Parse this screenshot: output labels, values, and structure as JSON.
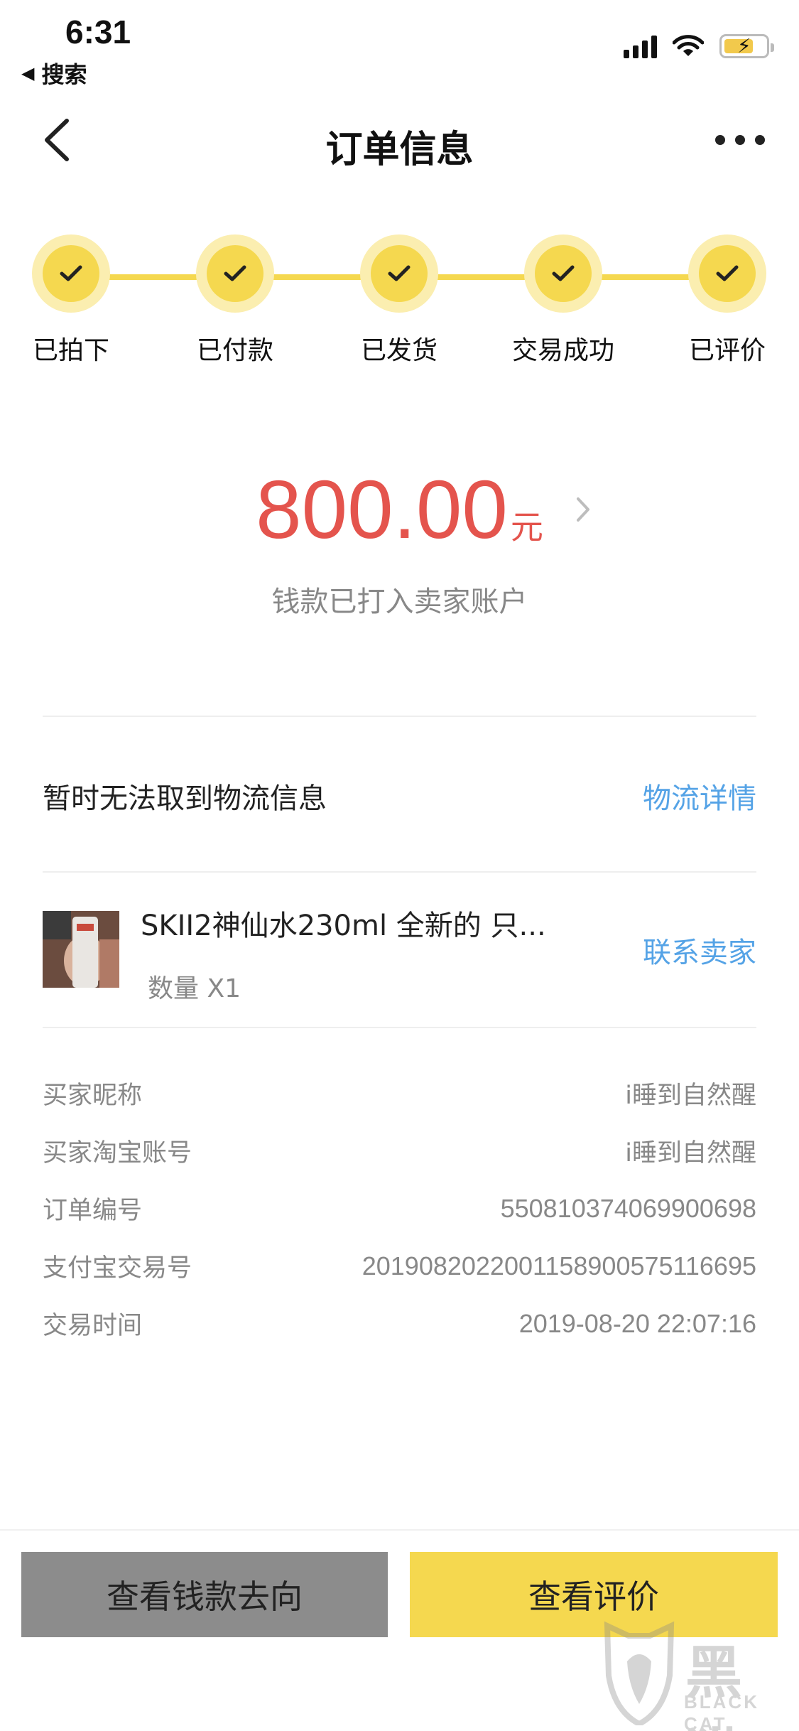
{
  "status_bar": {
    "time": "6:31",
    "back_app": "搜索"
  },
  "nav": {
    "title": "订单信息"
  },
  "progress": {
    "colors": {
      "accent": "#f5d84f",
      "halo": "#fbeeb0"
    },
    "steps": [
      {
        "label": "已拍下",
        "done": true
      },
      {
        "label": "已付款",
        "done": true
      },
      {
        "label": "已发货",
        "done": true
      },
      {
        "label": "交易成功",
        "done": true
      },
      {
        "label": "已评价",
        "done": true
      }
    ]
  },
  "amount": {
    "value": "800.00",
    "unit": "元",
    "note": "钱款已打入卖家账户",
    "color": "#e4544d"
  },
  "logistics": {
    "text": "暂时无法取到物流信息",
    "link": "物流详情"
  },
  "product": {
    "title": "SKII2神仙水230ml 全新的 只...",
    "quantity": "数量 X1",
    "contact": "联系卖家"
  },
  "info": [
    {
      "label": "买家昵称",
      "value": "i睡到自然醒"
    },
    {
      "label": "买家淘宝账号",
      "value": "i睡到自然醒"
    },
    {
      "label": "订单编号",
      "value": "550810374069900698"
    },
    {
      "label": "支付宝交易号",
      "value": "2019082022001158900575116695"
    },
    {
      "label": "交易时间",
      "value": "2019-08-20 22:07:16"
    }
  ],
  "buttons": {
    "money_flow": "查看钱款去向",
    "view_review": "查看评价"
  },
  "watermark": {
    "cn": "黑猫",
    "en": "BLACK CAT"
  }
}
